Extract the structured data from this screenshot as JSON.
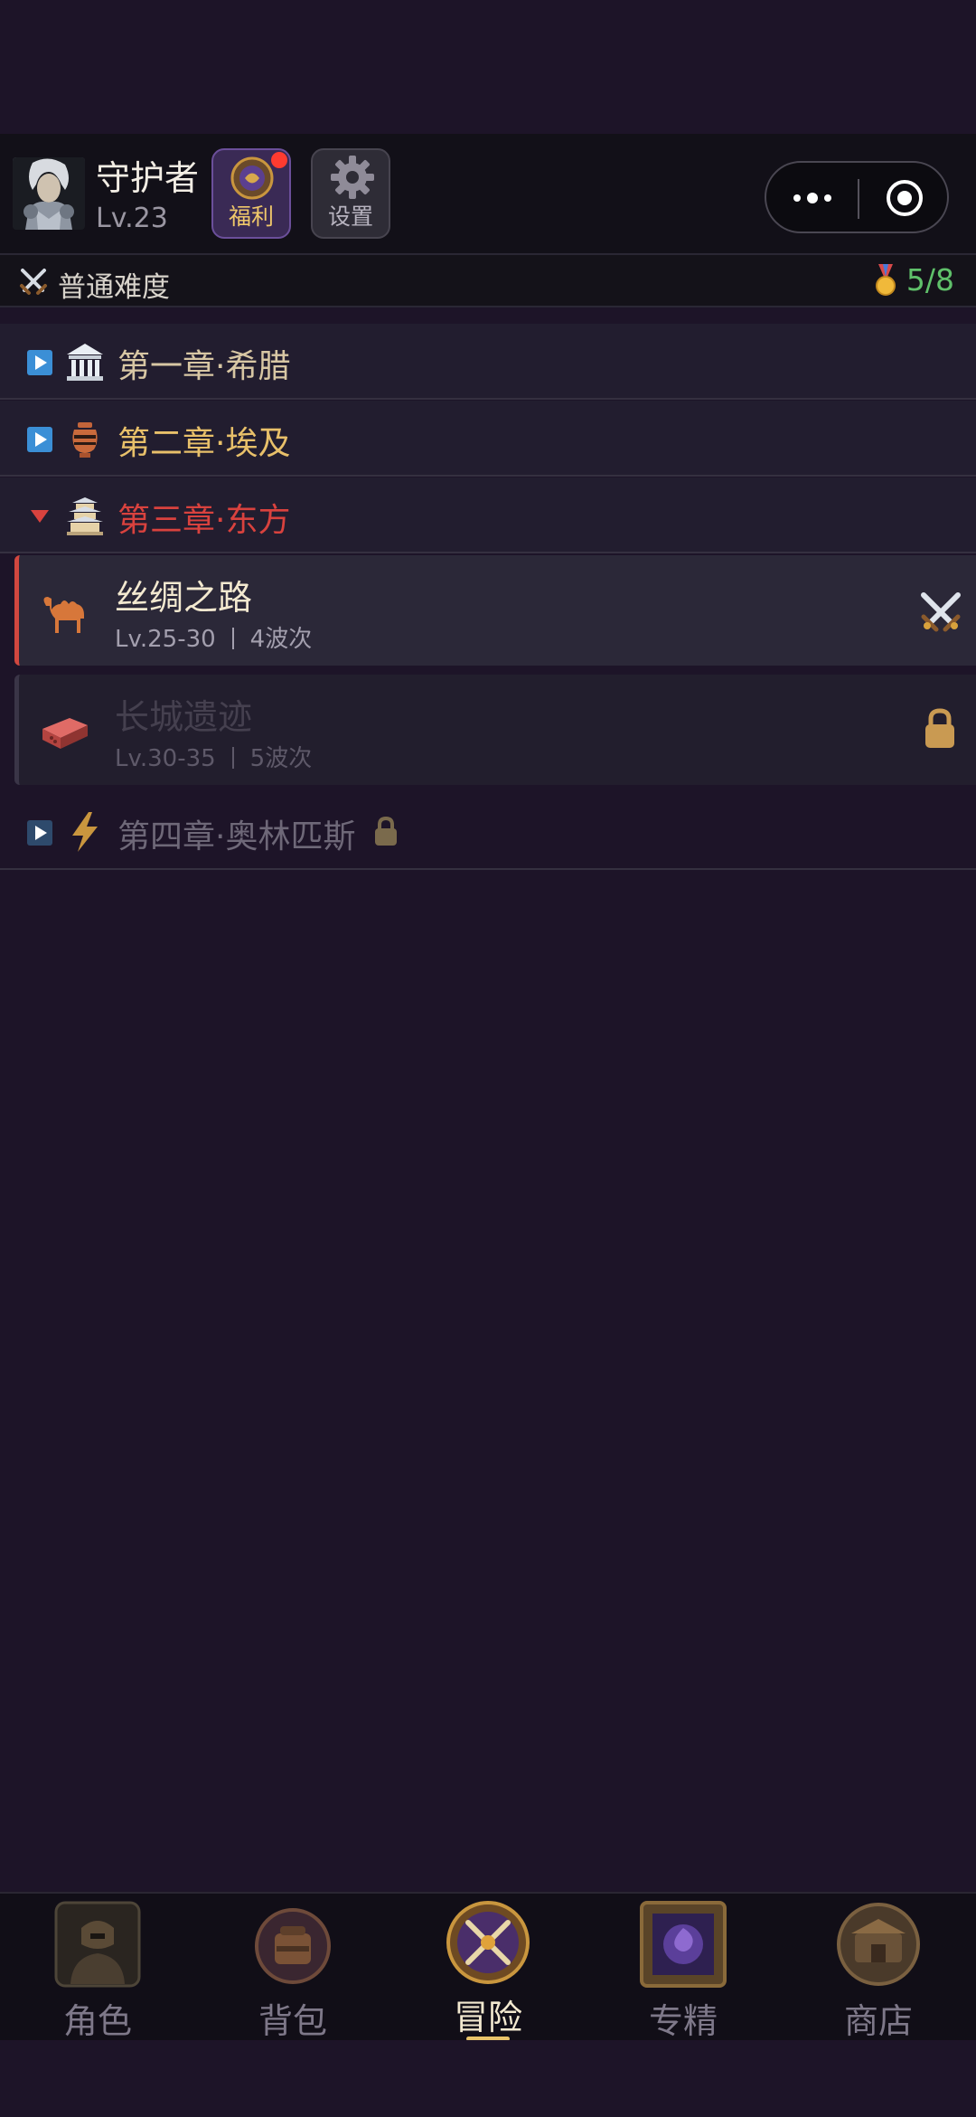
{
  "header": {
    "player_name": "守护者",
    "player_level": "Lv.23",
    "welfare_label": "福利",
    "settings_label": "设置"
  },
  "difficulty": {
    "label": "普通难度",
    "progress": "5/8"
  },
  "chapters": [
    {
      "title": "第一章·希腊",
      "expanded": false,
      "locked": false,
      "color": "#d8c7a4",
      "icon": "temple-icon"
    },
    {
      "title": "第二章·埃及",
      "expanded": false,
      "locked": false,
      "color": "#e8c06a",
      "icon": "amphora-icon"
    },
    {
      "title": "第三章·东方",
      "expanded": true,
      "locked": false,
      "color": "#d9423e",
      "icon": "pagoda-icon"
    },
    {
      "title": "第四章·奥林匹斯",
      "expanded": false,
      "locked": true,
      "color": "#6e6878",
      "icon": "lightning-icon"
    }
  ],
  "stages": [
    {
      "name": "丝绸之路",
      "level": "Lv.25-30",
      "waves": "4波次",
      "locked": false,
      "icon": "camel-icon",
      "action_icon": "crossed-swords-icon"
    },
    {
      "name": "长城遗迹",
      "level": "Lv.30-35",
      "waves": "5波次",
      "locked": true,
      "icon": "brick-icon",
      "action_icon": "lock-icon"
    }
  ],
  "nav": [
    {
      "label": "角色",
      "active": false,
      "icon": "character-icon"
    },
    {
      "label": "背包",
      "active": false,
      "icon": "backpack-icon"
    },
    {
      "label": "冒险",
      "active": true,
      "icon": "adventure-icon"
    },
    {
      "label": "专精",
      "active": false,
      "icon": "mastery-icon"
    },
    {
      "label": "商店",
      "active": false,
      "icon": "shop-icon"
    }
  ],
  "colors": {
    "background": "#1d1428",
    "accent_gold": "#e9c46a",
    "active_red": "#d2473f",
    "progress_green": "#5fc06a"
  }
}
